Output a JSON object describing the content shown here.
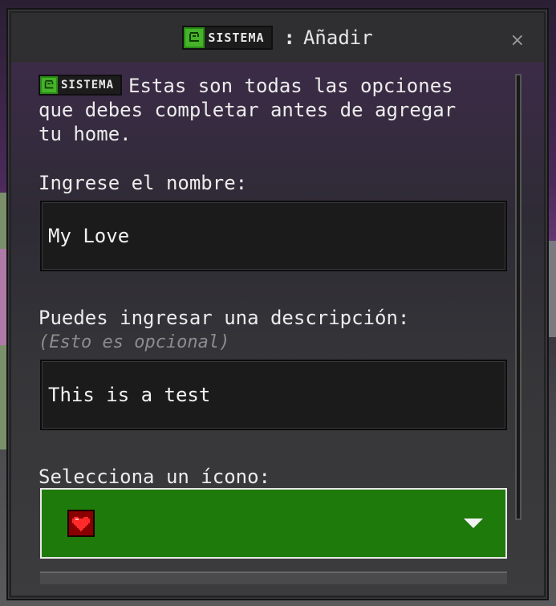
{
  "window": {
    "badge_label": "SISTEMA",
    "separator": ":",
    "title": "Añadir",
    "close_label": "×"
  },
  "intro": {
    "badge_label": "SISTEMA",
    "text": "Estas son todas las opciones que debes completar antes de agregar tu home."
  },
  "name_field": {
    "label": "Ingrese el nombre:",
    "value": "My Love"
  },
  "description_field": {
    "label": "Puedes ingresar una descripción:",
    "hint": "(Esto es opcional)",
    "value": "This is a test"
  },
  "icon_select": {
    "label": "Selecciona un ícono:",
    "selected_icon": "heart-icon"
  },
  "colors": {
    "brand_green": "#46b32a",
    "select_green": "#1f7a0c",
    "heart_red": "#8a0000"
  }
}
